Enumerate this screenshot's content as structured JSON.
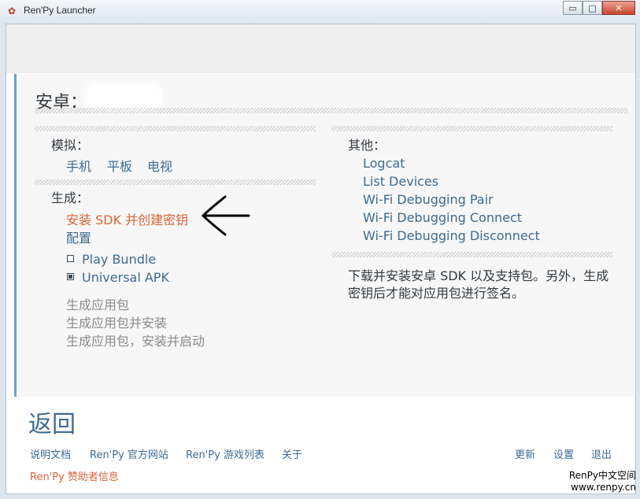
{
  "window": {
    "title": "Ren'Py Launcher",
    "controls": {
      "minimize": "▭",
      "maximize": "□",
      "close": "✕"
    }
  },
  "android": {
    "heading": "安卓：",
    "emulation": {
      "label": "模拟：",
      "items": [
        "手机",
        "平板",
        "电视"
      ]
    },
    "build": {
      "label": "生成：",
      "install_sdk": "安装 SDK 并创建密钥",
      "configure": "配置",
      "bundle_options": [
        {
          "label": "Play Bundle",
          "selected": false
        },
        {
          "label": "Universal APK",
          "selected": true
        }
      ],
      "actions": [
        "生成应用包",
        "生成应用包并安装",
        "生成应用包，安装并启动"
      ]
    },
    "other": {
      "label": "其他：",
      "items": [
        "Logcat",
        "List Devices",
        "Wi-Fi Debugging Pair",
        "Wi-Fi Debugging Connect",
        "Wi-Fi Debugging Disconnect"
      ]
    },
    "description": "下载并安装安卓 SDK 以及支持包。另外，生成密钥后才能对应用包进行签名。"
  },
  "footer": {
    "back": "返回",
    "links_left": [
      "说明文档",
      "Ren'Py 官方网站",
      "Ren'Py 游戏列表",
      "关于"
    ],
    "links_right": [
      "更新",
      "设置",
      "退出"
    ],
    "sponsor": "Ren'Py 赞助者信息"
  },
  "watermark": {
    "line1": "RenPy中文空间",
    "line2": "www.renpy.cn"
  },
  "colors": {
    "link": "#3f6a91",
    "accent": "#d9643a",
    "rail": "#6f9fc9"
  },
  "icons": {
    "app": "renpy-logo-icon",
    "annotation": "hand-drawn-arrow-icon"
  }
}
